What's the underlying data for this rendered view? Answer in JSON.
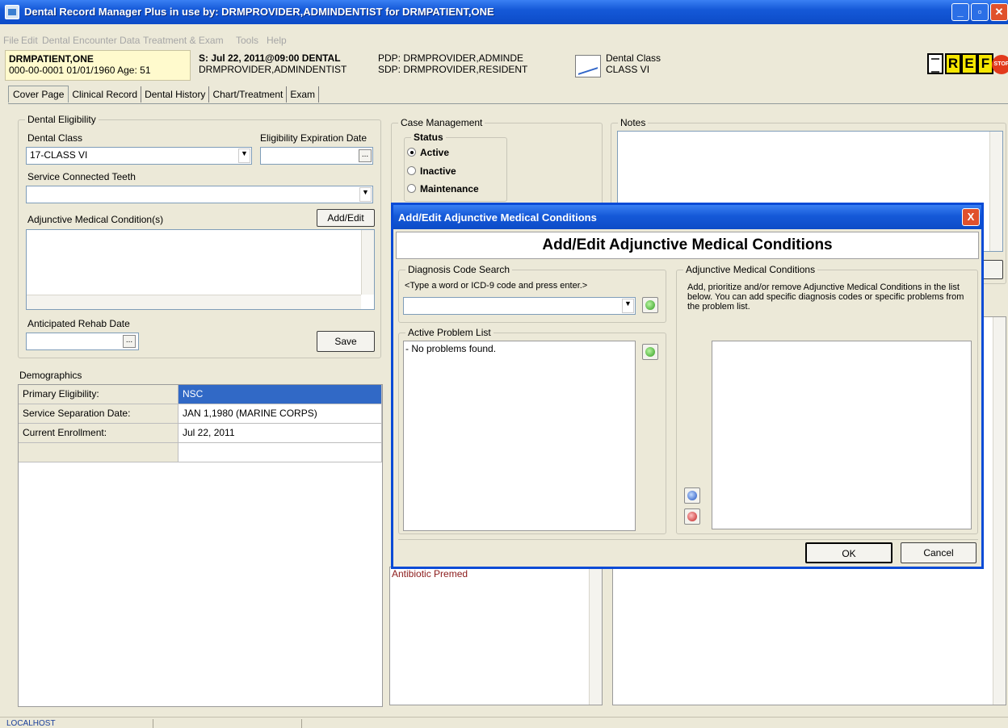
{
  "window": {
    "title": "Dental Record Manager Plus in use by: DRMPROVIDER,ADMINDENTIST for DRMPATIENT,ONE"
  },
  "menu": [
    "File",
    "Edit",
    "Dental Encounter Data",
    "Treatment & Exam",
    "Tools",
    "Help"
  ],
  "patient": {
    "name": "DRMPATIENT,ONE",
    "id_line": "000-00-0001   01/01/1960 Age:  51"
  },
  "encounter": {
    "line1": "S: Jul 22, 2011@09:00 DENTAL",
    "line2": "DRMPROVIDER,ADMINDENTIST"
  },
  "providers": {
    "pdp": "PDP: DRMPROVIDER,ADMINDE",
    "sdp": "SDP: DRMPROVIDER,RESIDENT"
  },
  "dental_class_header": {
    "label": "Dental Class",
    "value": "CLASS VI"
  },
  "header_buttons": {
    "r": "R",
    "e": "E",
    "f": "F",
    "stop": "STOP"
  },
  "tabs": [
    "Cover Page",
    "Clinical Record",
    "Dental History",
    "Chart/Treatment",
    "Exam"
  ],
  "eligibility": {
    "group_label": "Dental Eligibility",
    "dental_class_label": "Dental Class",
    "dental_class_value": "17-CLASS VI",
    "expiration_label": "Eligibility Expiration Date",
    "expiration_value": "",
    "service_teeth_label": "Service Connected Teeth",
    "service_teeth_value": "",
    "adjunctive_label": "Adjunctive Medical Condition(s)",
    "add_edit_label": "Add/Edit",
    "rehab_label": "Anticipated Rehab Date",
    "save_label": "Save",
    "ellipsis": "..."
  },
  "demographics": {
    "label": "Demographics",
    "rows": [
      {
        "label": "Primary Eligibility:",
        "value": "NSC"
      },
      {
        "label": "Service Separation Date:",
        "value": "JAN 1,1980  (MARINE CORPS)"
      },
      {
        "label": "Current Enrollment:",
        "value": "Jul 22, 2011"
      },
      {
        "label": "",
        "value": ""
      }
    ]
  },
  "case_management": {
    "label": "Case Management",
    "status_label": "Status",
    "options": [
      "Active",
      "Inactive",
      "Maintenance"
    ],
    "selected": "Active"
  },
  "notes": {
    "label": "Notes"
  },
  "premed": {
    "text": "Antibiotic Premed"
  },
  "dialog": {
    "title": "Add/Edit Adjunctive Medical Conditions",
    "header": "Add/Edit Adjunctive Medical Conditions",
    "close": "X",
    "diag_search": {
      "label": "Diagnosis Code Search",
      "hint": "<Type a word or ICD-9 code and press enter.>",
      "value": ""
    },
    "problem_list": {
      "label": "Active Problem List",
      "items": [
        " - No problems found."
      ]
    },
    "adjunctive": {
      "label": "Adjunctive Medical Conditions",
      "instructions": "Add, prioritize and/or remove Adjunctive Medical Conditions in the list below.  You can add specific diagnosis codes or specific problems from the problem list."
    },
    "ok_label": "OK",
    "cancel_label": "Cancel"
  },
  "status_bar": {
    "server": "LOCALHOST"
  },
  "colors": {
    "titlebar": "#0c4bc7",
    "selection": "#3169c6",
    "dialog_border": "#0a4bd6",
    "premed_text": "#8b1a1a"
  }
}
